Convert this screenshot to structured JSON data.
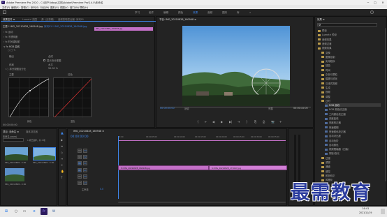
{
  "app": {
    "title": "Adobe Premiere Pro 2020 - C:\\用户\\ldbsp\\文档\\Adobe\\Premiere Pro\\14.0\\未命名",
    "logo": "Pr",
    "window_controls": [
      "─",
      "□",
      "✕"
    ]
  },
  "menu": [
    "文件(F)",
    "编辑(E)",
    "剪辑(C)",
    "序列(S)",
    "标记(M)",
    "图形(G)",
    "视图(V)",
    "窗口(W)",
    "帮助(H)"
  ],
  "workspaces": {
    "items": [
      "学习",
      "组件",
      "编辑",
      "颜色",
      "效果",
      "音频",
      "图形",
      "库"
    ],
    "active_index": 4,
    "more": "»"
  },
  "effect_controls": {
    "tabs": [
      "效果控件 ≡",
      "Lumetri 范围",
      "源: (无剪辑)",
      "音频剪辑混合器: 序列01"
    ],
    "source_label": "主要 * IMG_20210828_160948.jpg",
    "sequence_label": "序列01 * IMG_20210828_160948.jpg",
    "rows": [
      {
        "label": "› fx  运动"
      },
      {
        "label": "› fx  不透明度"
      },
      {
        "label": "› fx  时间重映射"
      },
      {
        "label": "∨ fx  RGB 曲线"
      },
      {
        "label": "○ □ ✎"
      },
      {
        "label": "输出",
        "value": "合成"
      },
      {
        "label": "",
        "value": "显示拆分视图"
      },
      {
        "label": "布局",
        "value": "水平"
      },
      {
        "label": "› ○ 拆分视图百分比",
        "value": "50.00 %"
      },
      {
        "label": "主要",
        "value": "红色"
      }
    ],
    "curve_labels": [
      "绿色",
      "蓝色"
    ],
    "timecode": "00:00:00:00",
    "clip_label": "IMG_20210828_160948.jpg"
  },
  "program_monitor": {
    "tab": "节目: IMG_20210828_160948 ≡",
    "timecode_left": "00:00:00:00",
    "fit": "适合",
    "quality": "完整",
    "timecode_right": "00:00:10:00",
    "controls": [
      "{",
      "⇤",
      "◀",
      "▶",
      "▶|",
      "⇥",
      "}",
      "⎘",
      "⎙",
      "📷",
      "+"
    ]
  },
  "project": {
    "tabs": [
      "项目: 未命名 ≡",
      "媒体浏览器"
    ],
    "filename": "未命名.prproj",
    "item_count": "1 项已选择，共 3 项",
    "items": [
      {
        "name": "IMG_20210828...",
        "dur": "5:00"
      },
      {
        "name": "IMG_20210828...",
        "dur": "5:00"
      },
      {
        "name": "IMG_20210828...",
        "dur": "5:00"
      }
    ]
  },
  "timeline": {
    "tab": "IMG_20210828_160948 ≡",
    "timecode": "00:00:00:00",
    "ruler": [
      "00:00",
      "00:00:05:00",
      "00:00:10:00",
      "00:00:15:00",
      "00:00:20:00",
      "00:00:25:00",
      "00:00:30:00",
      "00:00:35:00",
      "00:00:40:00"
    ],
    "tracks": [
      "V3",
      "V2",
      "V1",
      "A1",
      "A2",
      "A3"
    ],
    "master_label": "主声道",
    "master_value": "0.0",
    "clips": [
      {
        "label": "fx IMG_20210828_160948.jpg"
      },
      {
        "label": "fx IMG_20210828_171647.jpg"
      }
    ]
  },
  "effects": {
    "tab": "效果 ≡",
    "items": [
      {
        "label": "预设",
        "kind": "folder",
        "indent": 0
      },
      {
        "label": "Lumetri 预设",
        "kind": "folder",
        "indent": 0
      },
      {
        "label": "音频效果",
        "kind": "folder",
        "indent": 0
      },
      {
        "label": "音频过渡",
        "kind": "folder",
        "indent": 0
      },
      {
        "label": "视频效果",
        "kind": "folder",
        "indent": 0
      },
      {
        "label": "变换",
        "kind": "folder",
        "indent": 1
      },
      {
        "label": "图像控制",
        "kind": "folder",
        "indent": 1
      },
      {
        "label": "实用程序",
        "kind": "folder",
        "indent": 1
      },
      {
        "label": "扭曲",
        "kind": "folder",
        "indent": 1
      },
      {
        "label": "时间",
        "kind": "folder",
        "indent": 1
      },
      {
        "label": "杂色与颗粒",
        "kind": "folder",
        "indent": 1
      },
      {
        "label": "模糊与锐化",
        "kind": "folder",
        "indent": 1
      },
      {
        "label": "沉浸式视频",
        "kind": "folder",
        "indent": 1
      },
      {
        "label": "生成",
        "kind": "folder",
        "indent": 1
      },
      {
        "label": "视频",
        "kind": "folder",
        "indent": 1
      },
      {
        "label": "调整",
        "kind": "folder",
        "indent": 1
      },
      {
        "label": "过时",
        "kind": "folder",
        "indent": 1
      },
      {
        "label": "RGB 曲线",
        "kind": "fx",
        "indent": 2
      },
      {
        "label": "RGB 颜色校正器",
        "kind": "fx",
        "indent": 2
      },
      {
        "label": "三向颜色校正器",
        "kind": "fx",
        "indent": 2
      },
      {
        "label": "亮度曲线",
        "kind": "fx",
        "indent": 2
      },
      {
        "label": "亮度校正器",
        "kind": "fx",
        "indent": 2
      },
      {
        "label": "快速模糊",
        "kind": "fx",
        "indent": 2
      },
      {
        "label": "快速颜色校正器",
        "kind": "fx",
        "indent": 2
      },
      {
        "label": "自动对比度",
        "kind": "fx",
        "indent": 2
      },
      {
        "label": "自动色阶",
        "kind": "fx",
        "indent": 2
      },
      {
        "label": "自动颜色",
        "kind": "fx",
        "indent": 2
      },
      {
        "label": "视频限幅器（旧版）",
        "kind": "fx",
        "indent": 2
      },
      {
        "label": "阴影/高光",
        "kind": "fx",
        "indent": 2
      },
      {
        "label": "过渡",
        "kind": "folder",
        "indent": 1
      },
      {
        "label": "透视",
        "kind": "folder",
        "indent": 1
      },
      {
        "label": "通道",
        "kind": "folder",
        "indent": 1
      },
      {
        "label": "键控",
        "kind": "folder",
        "indent": 1
      },
      {
        "label": "颜色校正",
        "kind": "folder",
        "indent": 1
      },
      {
        "label": "风格化",
        "kind": "folder",
        "indent": 1
      }
    ],
    "selected_index": 17
  },
  "taskbar": {
    "time": "14:41",
    "date": "2021/11/19"
  },
  "watermark": "最需教育",
  "colors": {
    "accent": "#3d84e8",
    "clip": "#c470c8",
    "watermark": "#2b3c9e"
  }
}
